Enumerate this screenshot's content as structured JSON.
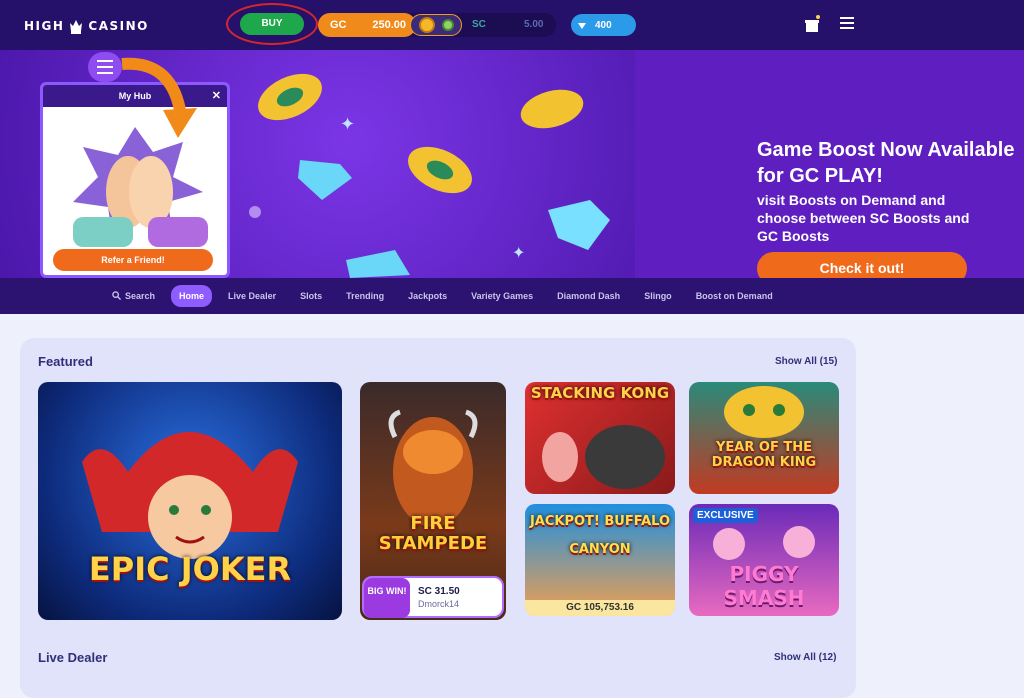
{
  "header": {
    "logo_left": "HIGH",
    "logo_right": "CASINO",
    "buy_label": "BUY",
    "gc_label": "GC",
    "gc_value": "250.00",
    "sc_label": "SC",
    "sc_value": "5.00",
    "gems": "400"
  },
  "hero": {
    "hub_title": "My Hub",
    "refer_label": "Refer a Friend!",
    "title": "Game Boost Now Available for GC PLAY!",
    "subtitle": "visit Boosts on Demand and choose between SC Boosts and GC Boosts",
    "cta": "Check it out!"
  },
  "nav": {
    "search": "Search",
    "items": [
      "Home",
      "Live Dealer",
      "Slots",
      "Trending",
      "Jackpots",
      "Variety Games",
      "Diamond Dash",
      "Slingo",
      "Boost on Demand"
    ]
  },
  "featured": {
    "title": "Featured",
    "show_all": "Show All (15)",
    "games": [
      "EPIC JOKER",
      "FIRE STAMPEDE",
      "STACKING KONG",
      "YEAR OF THE DRAGON KING",
      "JACKPOT! BUFFALO CANYON",
      "PIGGY SMASH"
    ],
    "bigwin": {
      "badge": "BIG WIN!",
      "value": "SC 31.50",
      "user": "Dmorck14"
    },
    "jackpot_value": "GC 105,753.16",
    "exclusive": "EXCLUSIVE"
  },
  "live": {
    "title": "Live Dealer",
    "show_all": "Show All (12)"
  },
  "colors": {
    "brand_dark": "#26116a",
    "buy": "#1ea84b",
    "accent": "#f06a1c",
    "purple": "#8f5cff"
  }
}
